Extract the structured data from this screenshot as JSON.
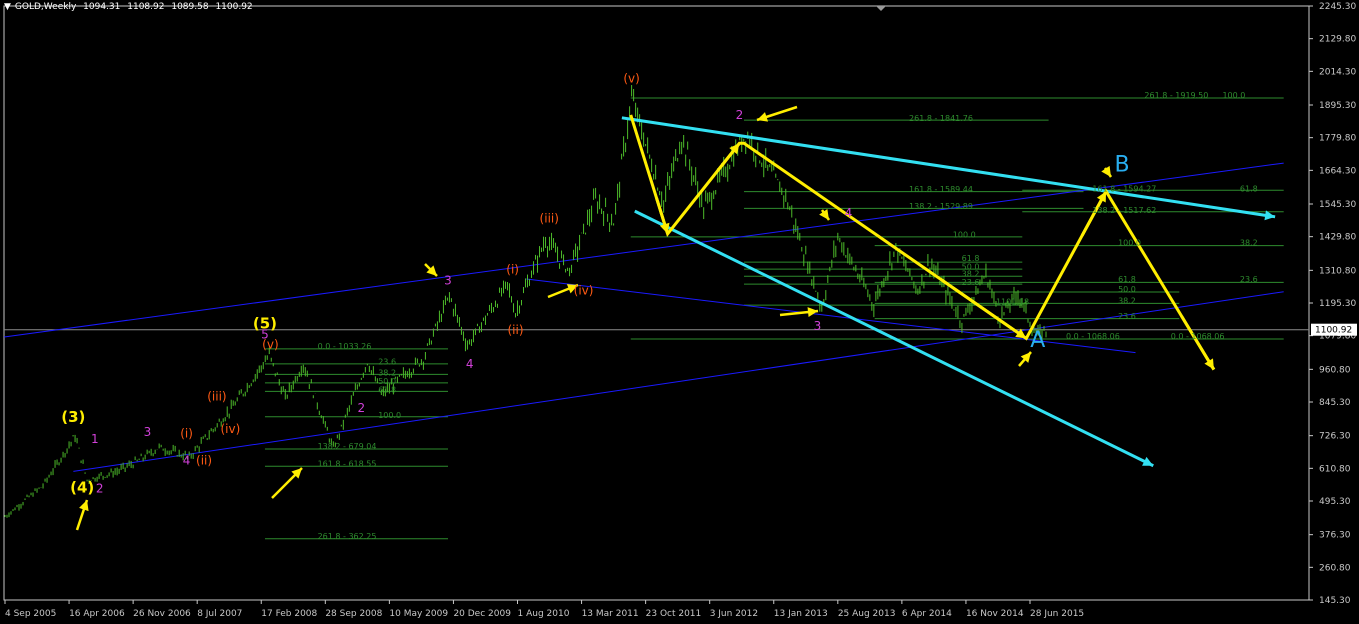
{
  "header": {
    "symbol": "GOLD,Weekly",
    "open": "1094.31",
    "high": "1108.92",
    "low": "1089.58",
    "close": "1100.92"
  },
  "colors": {
    "background": "#000000",
    "price_bars": "#4dbb2a",
    "axis": "#c8c8c8",
    "trend_blue": "#1a1aff",
    "cyan_arrow": "#33e0f2",
    "yellow_arrow": "#ffee00",
    "wave_orange": "#ff5a14",
    "wave_magenta": "#d040d8",
    "wave_yellow": "#ffee00",
    "fib_green": "#2e8b2e",
    "label_blue": "#29aef0"
  },
  "chart_data": {
    "type": "candlestick",
    "title": "",
    "xlabel": "",
    "ylabel": "",
    "ylim": [
      145.3,
      2245.3
    ],
    "current_price": "1100.92",
    "y_ticks": [
      "2245.30",
      "2129.80",
      "2014.30",
      "1895.30",
      "1779.80",
      "1664.30",
      "1545.30",
      "1429.80",
      "1310.80",
      "1195.30",
      "1079.80",
      "960.80",
      "845.30",
      "726.30",
      "610.80",
      "495.30",
      "376.30",
      "260.80",
      "145.30"
    ],
    "x_ticks": [
      "4 Sep 2005",
      "16 Apr 2006",
      "26 Nov 2006",
      "8 Jul 2007",
      "17 Feb 2008",
      "28 Sep 2008",
      "10 May 2009",
      "20 Dec 2009",
      "1 Aug 2010",
      "13 Mar 2011",
      "23 Oct 2011",
      "3 Jun 2012",
      "13 Jan 2013",
      "25 Aug 2013",
      "6 Apr 2014",
      "16 Nov 2014",
      "28 Jun 2015"
    ],
    "price_path": [
      {
        "date": "2005-09-04",
        "price": 440
      },
      {
        "date": "2006-01-15",
        "price": 550
      },
      {
        "date": "2006-05-07",
        "price": 725
      },
      {
        "date": "2006-06-18",
        "price": 570
      },
      {
        "date": "2006-10-01",
        "price": 600
      },
      {
        "date": "2006-12-10",
        "price": 635
      },
      {
        "date": "2007-02-25",
        "price": 685
      },
      {
        "date": "2007-06-10",
        "price": 650
      },
      {
        "date": "2007-11-11",
        "price": 830
      },
      {
        "date": "2008-03-16",
        "price": 1010
      },
      {
        "date": "2008-05-11",
        "price": 860
      },
      {
        "date": "2008-07-13",
        "price": 980
      },
      {
        "date": "2008-10-26",
        "price": 680
      },
      {
        "date": "2009-02-22",
        "price": 990
      },
      {
        "date": "2009-04-12",
        "price": 870
      },
      {
        "date": "2009-09-06",
        "price": 1000
      },
      {
        "date": "2009-12-06",
        "price": 1220
      },
      {
        "date": "2010-02-07",
        "price": 1045
      },
      {
        "date": "2010-06-27",
        "price": 1260
      },
      {
        "date": "2010-07-25",
        "price": 1160
      },
      {
        "date": "2010-11-07",
        "price": 1420
      },
      {
        "date": "2011-01-30",
        "price": 1310
      },
      {
        "date": "2011-05-01",
        "price": 1560
      },
      {
        "date": "2011-07-03",
        "price": 1480
      },
      {
        "date": "2011-09-04",
        "price": 1920
      },
      {
        "date": "2011-12-25",
        "price": 1550
      },
      {
        "date": "2012-02-26",
        "price": 1780
      },
      {
        "date": "2012-05-13",
        "price": 1530
      },
      {
        "date": "2012-10-07",
        "price": 1795
      },
      {
        "date": "2012-12-30",
        "price": 1660
      },
      {
        "date": "2013-02-24",
        "price": 1570
      },
      {
        "date": "2013-06-30",
        "price": 1180
      },
      {
        "date": "2013-08-25",
        "price": 1430
      },
      {
        "date": "2013-12-29",
        "price": 1190
      },
      {
        "date": "2014-03-16",
        "price": 1390
      },
      {
        "date": "2014-06-01",
        "price": 1240
      },
      {
        "date": "2014-07-13",
        "price": 1340
      },
      {
        "date": "2014-11-02",
        "price": 1130
      },
      {
        "date": "2015-01-25",
        "price": 1300
      },
      {
        "date": "2015-03-15",
        "price": 1140
      },
      {
        "date": "2015-05-17",
        "price": 1230
      },
      {
        "date": "2015-07-19",
        "price": 1080
      },
      {
        "date": "2015-08-23",
        "price": 1100
      }
    ],
    "fib_labels": [
      {
        "text": "261.8 - 1919.50",
        "date": "2016-08-01",
        "price": 1930
      },
      {
        "text": "100.0",
        "date": "2017-05-01",
        "price": 1930
      },
      {
        "text": "261.8 - 1841.76",
        "date": "2014-05-01",
        "price": 1850
      },
      {
        "text": "161.8 - 1589.44",
        "date": "2014-05-01",
        "price": 1598
      },
      {
        "text": "161.8 - 1594.27",
        "date": "2016-02-01",
        "price": 1600
      },
      {
        "text": "61.8",
        "date": "2017-07-01",
        "price": 1600
      },
      {
        "text": "138.2 - 1529.89",
        "date": "2014-05-01",
        "price": 1538
      },
      {
        "text": "138.2 - 1517.62",
        "date": "2016-02-01",
        "price": 1524
      },
      {
        "text": "100.0",
        "date": "2014-10-01",
        "price": 1438
      },
      {
        "text": "100.0",
        "date": "2016-05-01",
        "price": 1410
      },
      {
        "text": "38.2",
        "date": "2017-07-01",
        "price": 1410
      },
      {
        "text": "61.8",
        "date": "2014-11-01",
        "price": 1355
      },
      {
        "text": "50.0",
        "date": "2014-11-01",
        "price": 1325
      },
      {
        "text": "38.2",
        "date": "2014-11-01",
        "price": 1300
      },
      {
        "text": "23.6",
        "date": "2014-11-01",
        "price": 1270
      },
      {
        "text": "61.8",
        "date": "2016-05-01",
        "price": 1280
      },
      {
        "text": "23.6",
        "date": "2017-07-01",
        "price": 1280
      },
      {
        "text": "50.0",
        "date": "2016-05-01",
        "price": 1245
      },
      {
        "text": "38.2",
        "date": "2016-05-01",
        "price": 1205
      },
      {
        "text": "1101.18",
        "date": "2015-03-01",
        "price": 1200
      },
      {
        "text": "23.6",
        "date": "2016-05-01",
        "price": 1150
      },
      {
        "text": "0.0 - 1068.06",
        "date": "2015-11-01",
        "price": 1078
      },
      {
        "text": "0.0 - 1068.06",
        "date": "2016-11-01",
        "price": 1078
      },
      {
        "text": "0.0 - 1033.26",
        "date": "2008-09-01",
        "price": 1043
      },
      {
        "text": "23.6",
        "date": "2009-04-01",
        "price": 988
      },
      {
        "text": "38.2",
        "date": "2009-04-01",
        "price": 950
      },
      {
        "text": "50.0",
        "date": "2009-04-01",
        "price": 920
      },
      {
        "text": "61.8",
        "date": "2009-04-01",
        "price": 890
      },
      {
        "text": "100.0",
        "date": "2009-04-01",
        "price": 800
      },
      {
        "text": "138.2 - 679.04",
        "date": "2008-09-01",
        "price": 689
      },
      {
        "text": "161.8 - 618.55",
        "date": "2008-09-01",
        "price": 628
      },
      {
        "text": "261.8 - 362.25",
        "date": "2008-09-01",
        "price": 372
      }
    ],
    "wave_labels": [
      {
        "text": "(3)",
        "date": "2006-05-01",
        "price": 775,
        "color": "#ffee00",
        "size": "large"
      },
      {
        "text": "1",
        "date": "2006-07-15",
        "price": 700,
        "color": "#d040d8",
        "size": "medium"
      },
      {
        "text": "(4)",
        "date": "2006-06-01",
        "price": 525,
        "color": "#ffee00",
        "size": "large"
      },
      {
        "text": "2",
        "date": "2006-08-01",
        "price": 525,
        "color": "#d040d8",
        "size": "medium"
      },
      {
        "text": "3",
        "date": "2007-01-15",
        "price": 725,
        "color": "#d040d8",
        "size": "medium"
      },
      {
        "text": "(i)",
        "date": "2007-06-01",
        "price": 720,
        "color": "#ff5a14",
        "size": "medium"
      },
      {
        "text": "4",
        "date": "2007-06-01",
        "price": 625,
        "color": "#d040d8",
        "size": "medium"
      },
      {
        "text": "(ii)",
        "date": "2007-08-01",
        "price": 625,
        "color": "#ff5a14",
        "size": "medium"
      },
      {
        "text": "(iii)",
        "date": "2007-09-15",
        "price": 850,
        "color": "#ff5a14",
        "size": "medium"
      },
      {
        "text": "(iv)",
        "date": "2007-11-01",
        "price": 735,
        "color": "#ff5a14",
        "size": "medium"
      },
      {
        "text": "(5)",
        "date": "2008-03-01",
        "price": 1105,
        "color": "#ffee00",
        "size": "large"
      },
      {
        "text": "5",
        "date": "2008-03-01",
        "price": 1070,
        "color": "#d040d8",
        "size": "medium"
      },
      {
        "text": "(v)",
        "date": "2008-03-20",
        "price": 1035,
        "color": "#ff5a14",
        "size": "medium"
      },
      {
        "text": "2",
        "date": "2009-02-01",
        "price": 810,
        "color": "#d040d8",
        "size": "medium"
      },
      {
        "text": "3",
        "date": "2009-12-01",
        "price": 1260,
        "color": "#d040d8",
        "size": "medium"
      },
      {
        "text": "4",
        "date": "2010-02-15",
        "price": 965,
        "color": "#d040d8",
        "size": "medium"
      },
      {
        "text": "(i)",
        "date": "2010-07-15",
        "price": 1300,
        "color": "#ff5a14",
        "size": "medium"
      },
      {
        "text": "(ii)",
        "date": "2010-07-25",
        "price": 1085,
        "color": "#ff5a14",
        "size": "medium"
      },
      {
        "text": "(iii)",
        "date": "2010-11-20",
        "price": 1480,
        "color": "#ff5a14",
        "size": "medium"
      },
      {
        "text": "(iv)",
        "date": "2011-03-20",
        "price": 1225,
        "color": "#ff5a14",
        "size": "medium"
      },
      {
        "text": "(v)",
        "date": "2011-09-04",
        "price": 1975,
        "color": "#ff5a14",
        "size": "medium"
      },
      {
        "text": "2",
        "date": "2012-09-15",
        "price": 1845,
        "color": "#d040d8",
        "size": "medium"
      },
      {
        "text": "4",
        "date": "2013-10-01",
        "price": 1500,
        "color": "#d040d8",
        "size": "medium"
      },
      {
        "text": "3",
        "date": "2013-06-15",
        "price": 1100,
        "color": "#d040d8",
        "size": "medium"
      },
      {
        "text": "A",
        "date": "2015-07-25",
        "price": 1040,
        "color": "#29aef0",
        "size": "xlarge"
      },
      {
        "text": "B",
        "date": "2016-05-15",
        "price": 1660,
        "color": "#29aef0",
        "size": "xlarge"
      }
    ]
  }
}
